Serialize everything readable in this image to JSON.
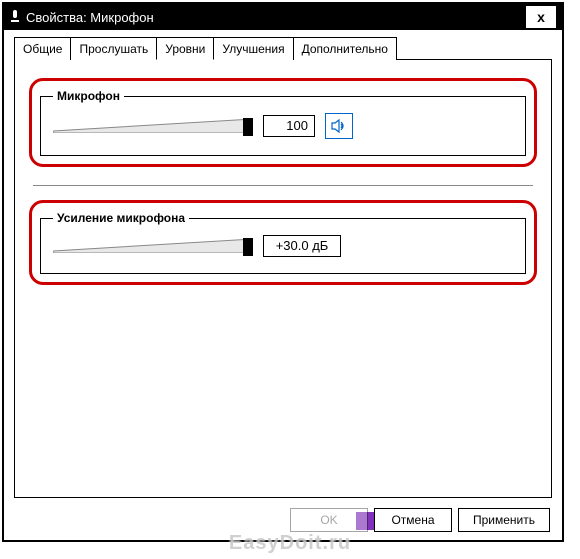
{
  "titlebar": {
    "title": "Свойства: Микрофон",
    "close": "x"
  },
  "tabs": [
    {
      "label": "Общие"
    },
    {
      "label": "Прослушать"
    },
    {
      "label": "Уровни"
    },
    {
      "label": "Улучшения"
    },
    {
      "label": "Дополнительно"
    }
  ],
  "active_tab": 2,
  "microphone": {
    "legend": "Микрофон",
    "value": "100",
    "slider_percent": 100
  },
  "gain": {
    "legend": "Усиление микрофона",
    "value": "+30.0 дБ",
    "slider_percent": 100
  },
  "buttons": {
    "ok": "OK",
    "cancel": "Отмена",
    "apply": "Применить"
  },
  "watermark": "EasyDoit.ru"
}
